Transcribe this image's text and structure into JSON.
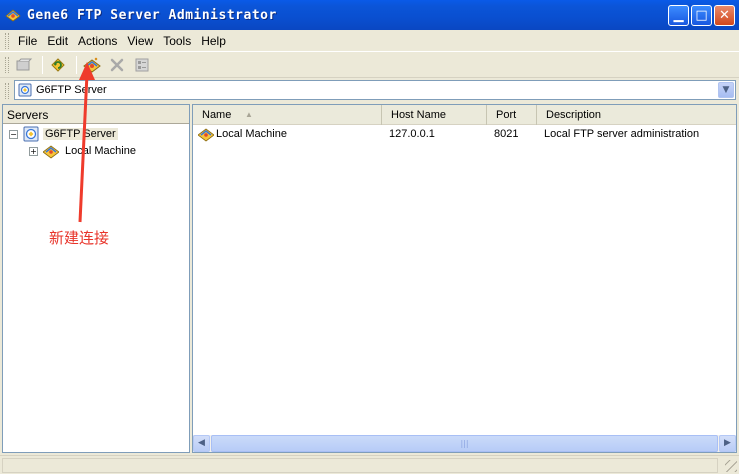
{
  "window": {
    "title": "Gene6 FTP Server Administrator",
    "icon": "g6ftp-app-icon"
  },
  "menubar": {
    "items": [
      "File",
      "Edit",
      "Actions",
      "View",
      "Tools",
      "Help"
    ]
  },
  "toolbar": {
    "buttons": [
      {
        "icon": "connect-icon",
        "enabled": false
      },
      {
        "icon": "refresh-icon",
        "enabled": true
      },
      {
        "icon": "new-connection-icon",
        "enabled": true
      },
      {
        "icon": "delete-icon",
        "enabled": false
      },
      {
        "icon": "properties-icon",
        "enabled": false
      }
    ]
  },
  "server_select": {
    "value": "G6FTP Server"
  },
  "servers_pane": {
    "header": "Servers",
    "tree": [
      {
        "label": "G6FTP Server",
        "expander": "−",
        "selected": true,
        "level": 0
      },
      {
        "label": "Local Machine",
        "expander": "+",
        "selected": false,
        "level": 1
      }
    ]
  },
  "list": {
    "columns": [
      "Name",
      "Host Name",
      "Port",
      "Description"
    ],
    "rows": [
      {
        "name": "Local Machine",
        "host": "127.0.0.1",
        "port": "8021",
        "description": "Local FTP server administration"
      }
    ]
  },
  "annotation": {
    "label": "新建连接",
    "color": "#e8342a"
  },
  "colors": {
    "titlebar": "#0a55d8",
    "chrome": "#ece9d8",
    "border": "#7f9db9"
  }
}
